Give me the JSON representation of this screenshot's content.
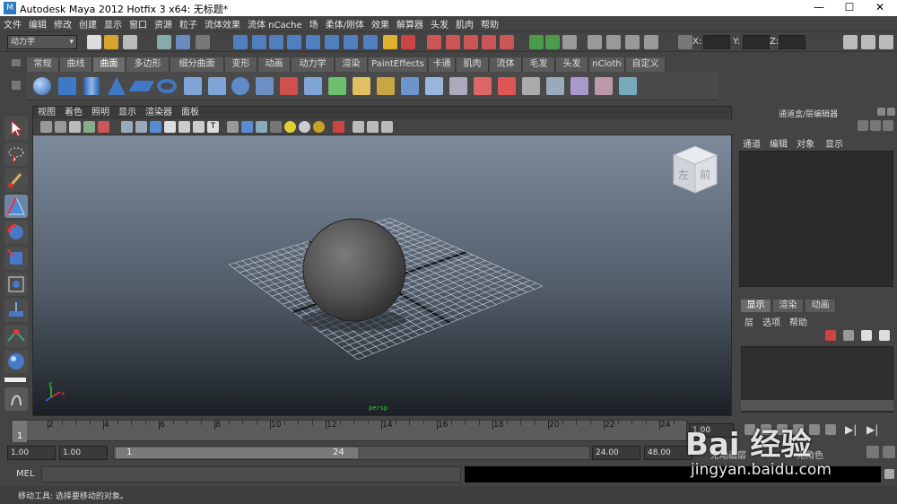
{
  "window": {
    "title": "Autodesk Maya 2012 Hotfix 3 x64: 无标题*",
    "minimize": "—",
    "maximize": "☐",
    "close": "✕"
  },
  "menu": [
    "文件",
    "编辑",
    "修改",
    "创建",
    "显示",
    "窗口",
    "资源",
    "粒子",
    "流体效果",
    "流体 nCache",
    "场",
    "柔体/刚体",
    "效果",
    "解算器",
    "头发",
    "肌肉",
    "帮助"
  ],
  "status": {
    "menuset": "动力学",
    "x_label": "X:",
    "y_label": "Y:",
    "z_label": "Z:"
  },
  "shelf": {
    "tabs": [
      "常规",
      "曲线",
      "曲面",
      "多边形",
      "细分曲面",
      "变形",
      "动画",
      "动力学",
      "渲染",
      "PaintEffects",
      "卡通",
      "肌肉",
      "流体",
      "毛发",
      "头发",
      "nCloth",
      "自定义"
    ],
    "active": "曲面"
  },
  "panel": {
    "menus": [
      "视图",
      "着色",
      "照明",
      "显示",
      "渲染器",
      "面板"
    ],
    "view_cube": {
      "left": "左",
      "front": "前"
    },
    "camera": "persp"
  },
  "channel_box": {
    "title": "通道盒/层编辑器",
    "menus": [
      "通道",
      "编辑",
      "对象",
      "显示"
    ]
  },
  "layer_editor": {
    "tabs": [
      "显示",
      "渲染",
      "动画"
    ],
    "active": "显示",
    "menus": [
      "层",
      "选项",
      "帮助"
    ]
  },
  "timeline": {
    "ticks": [
      "2",
      "4",
      "6",
      "8",
      "10",
      "12",
      "14",
      "16",
      "18",
      "20",
      "22",
      "24"
    ],
    "current": "1",
    "current_field": "1.00"
  },
  "range": {
    "start": "1.00",
    "start2": "1.00",
    "slider_start": "1",
    "slider_end": "24",
    "end": "24.00",
    "end2": "48.00",
    "anim_layer": "无动画层",
    "character": "无角色"
  },
  "mel": {
    "label": "MEL"
  },
  "help": {
    "text": "移动工具: 选择要移动的对象。"
  },
  "watermark": {
    "logo": "Bai 经验",
    "url": "jingyan.baidu.com"
  }
}
